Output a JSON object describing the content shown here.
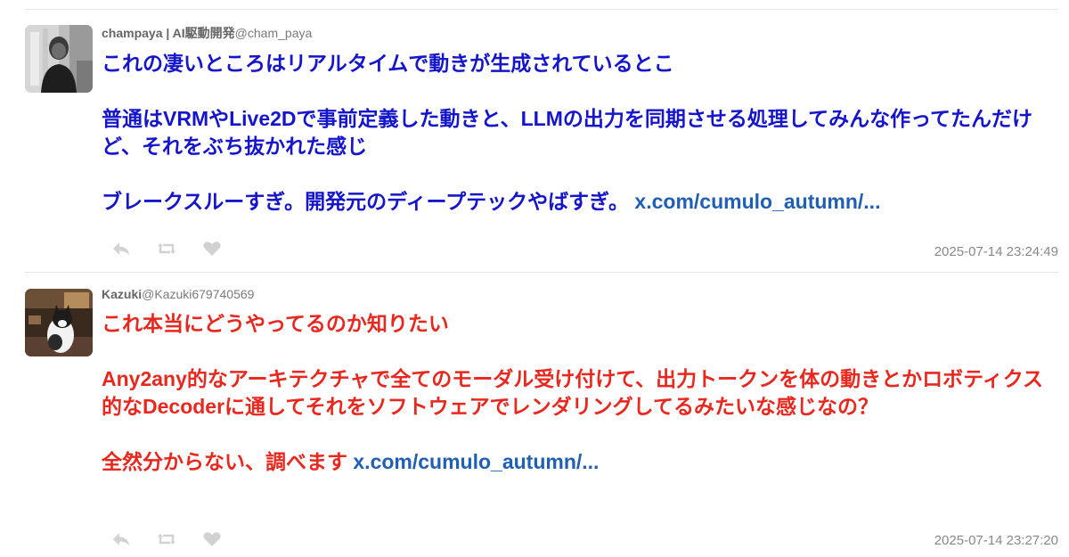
{
  "colors": {
    "tweet1_text": "#1515cc",
    "tweet2_text": "#e8281e",
    "link": "#1f5fb4",
    "meta": "#888888",
    "icon": "#d2d2d2"
  },
  "tweets": [
    {
      "display_name": "champaya | AI駆動開発",
      "handle": "@cham_paya",
      "text": "これの凄いところはリアルタイムで動きが生成されているとこ\n\n普通はVRMやLive2Dで事前定義した動きと、LLMの出力を同期させる処理してみんな作ってたんだけど、それをぶち抜かれた感じ\n\nブレークスルーすぎ。開発元のディープテックやばすぎ。 ",
      "link": "x.com/cumulo_autumn/...",
      "timestamp": "2025-07-14 23:24:49",
      "avatar": "avatar-photo-man"
    },
    {
      "display_name": "Kazuki",
      "handle": "@Kazuki679740569",
      "text": "これ本当にどうやってるのか知りたい\n\nAny2any的なアーキテクチャで全てのモーダル受け付けて、出力トークンを体の動きとかロボティクス的なDecoderに通してそれをソフトウェアでレンダリングしてるみたいな感じなの？\n\n全然分からない、調べます ",
      "link": "x.com/cumulo_autumn/...",
      "timestamp": "2025-07-14 23:27:20",
      "avatar": "avatar-photo-cat"
    }
  ],
  "icons": {
    "reply": "reply-icon",
    "retweet": "retweet-icon",
    "like": "like-icon"
  }
}
